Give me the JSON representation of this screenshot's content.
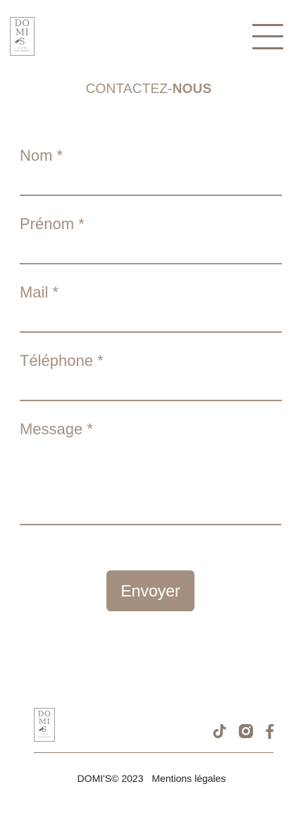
{
  "brand": {
    "logo_lines": [
      "DO",
      "MI",
      "S"
    ],
    "logo_tagline": [
      "LE SAVOIR",
      "FAIRE DOMINIQUE"
    ]
  },
  "header": {
    "menu_icon": "hamburger-menu-icon"
  },
  "page": {
    "title_light": "CONTACTEZ-",
    "title_bold": "NOUS"
  },
  "form": {
    "fields": [
      {
        "label": "Nom *",
        "value": ""
      },
      {
        "label": "Prénom *",
        "value": ""
      },
      {
        "label": "Mail *",
        "value": ""
      },
      {
        "label": "Téléphone *",
        "value": ""
      },
      {
        "label": "Message *",
        "value": ""
      }
    ],
    "submit_label": "Envoyer"
  },
  "footer": {
    "social_icons": [
      "tiktok-icon",
      "instagram-icon",
      "facebook-icon"
    ],
    "copyright": "DOMI'S© 2023",
    "legal_link": "Mentions légales"
  },
  "colors": {
    "accent": "#a48f80",
    "accent_dark": "#8a7c70",
    "text_dark": "#222222",
    "background": "#ffffff"
  }
}
